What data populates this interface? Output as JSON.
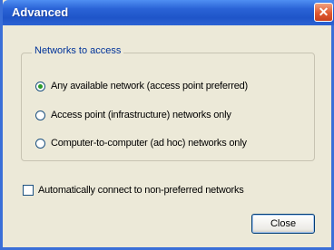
{
  "window": {
    "title": "Advanced",
    "close_glyph": "✕"
  },
  "group": {
    "legend": "Networks to access",
    "options": [
      {
        "label": "Any available network (access point preferred)",
        "selected": true
      },
      {
        "label": "Access point (infrastructure) networks only",
        "selected": false
      },
      {
        "label": "Computer-to-computer (ad hoc) networks only",
        "selected": false
      }
    ]
  },
  "auto_connect": {
    "label": "Automatically connect to non-preferred networks",
    "checked": false
  },
  "buttons": {
    "close": "Close"
  },
  "colors": {
    "titlebar": "#2a63d6",
    "face": "#ece9d8",
    "legend": "#003399",
    "close_button": "#e05a30"
  }
}
